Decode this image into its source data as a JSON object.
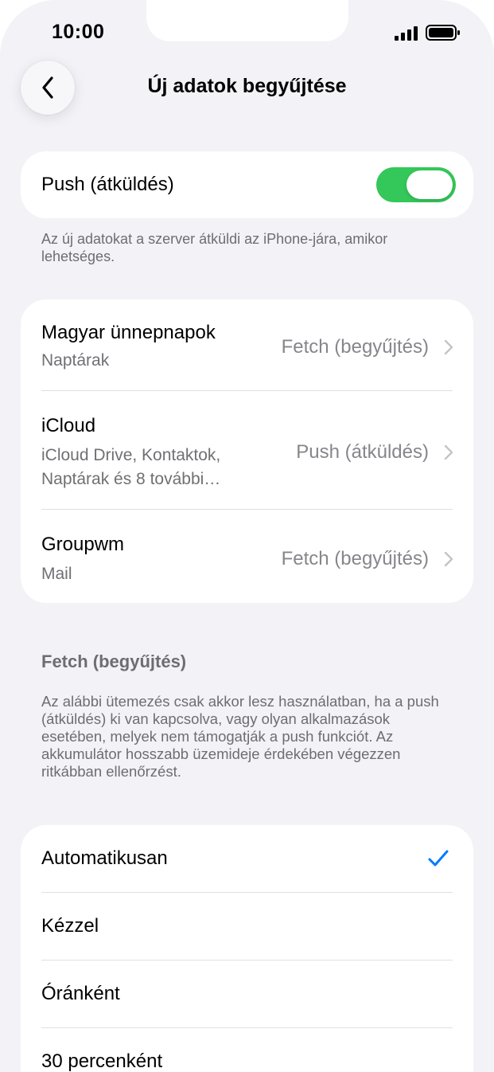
{
  "status_bar": {
    "time": "10:00"
  },
  "nav": {
    "title": "Új adatok begyűjtése",
    "back_icon": "chevron-left-icon"
  },
  "push": {
    "label": "Push (átküldés)",
    "enabled": true,
    "footnote": "Az új adatokat a szerver átküldi az iPhone-jára, amikor lehetséges."
  },
  "accounts": [
    {
      "name": "Magyar ünnepnapok",
      "subtitle": "Naptárak",
      "value": "Fetch (begyűjtés)"
    },
    {
      "name": "iCloud",
      "subtitle": "iCloud Drive, Kontaktok, Naptárak és 8 további…",
      "value": "Push (átküldés)"
    },
    {
      "name": "Groupwm",
      "subtitle": "Mail",
      "value": "Fetch (begyűjtés)"
    }
  ],
  "fetch": {
    "header": "Fetch (begyűjtés)",
    "footnote": "Az alábbi ütemezés csak akkor lesz használatban, ha a push (átküldés) ki van kapcsolva, vagy olyan alkalmazások esetében, melyek nem támogatják a push funkciót. Az akkumulátor hosszabb üzemideje érdekében végezzen ritkábban ellenőrzést."
  },
  "options": [
    {
      "label": "Automatikusan",
      "selected": true
    },
    {
      "label": "Kézzel",
      "selected": false
    },
    {
      "label": "Óránként",
      "selected": false
    },
    {
      "label": "30 percenként",
      "selected": false
    }
  ],
  "colors": {
    "background": "#f2f2f7",
    "toggle_on": "#34c759",
    "accent": "#007aff",
    "secondary_text": "#6d6d72"
  }
}
